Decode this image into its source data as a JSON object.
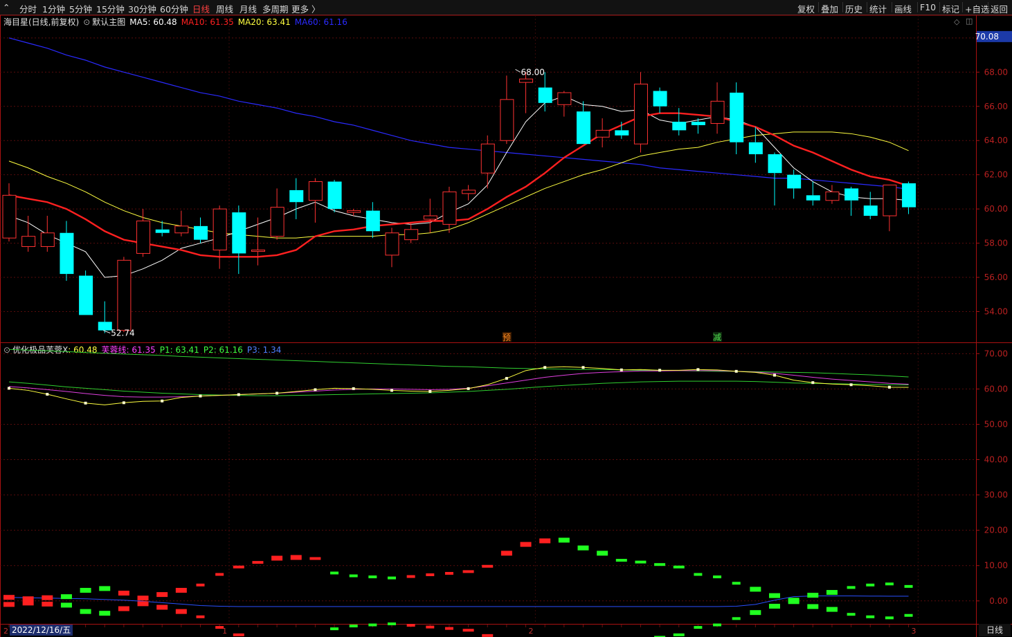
{
  "topbar": {
    "periods": [
      "分时",
      "1分钟",
      "5分钟",
      "15分钟",
      "30分钟",
      "60分钟",
      "日线",
      "周线",
      "月线",
      "多周期",
      "更多 〉"
    ],
    "active_period": "日线",
    "buttons": [
      "复权",
      "叠加",
      "历史",
      "统计",
      "画线",
      "F10",
      "标记",
      "+自选",
      "返回"
    ]
  },
  "main_legend": {
    "stock": "海目星(日线,前复权)",
    "template": "默认主图",
    "items": [
      {
        "label": "MA5: 60.48",
        "color": "#ffffff"
      },
      {
        "label": "MA10: 61.35",
        "color": "#ff2020"
      },
      {
        "label": "MA20: 63.41",
        "color": "#ffff40"
      },
      {
        "label": "MA60: 61.16",
        "color": "#2a2aff"
      }
    ]
  },
  "sub_legend": {
    "name": "优化极品芙蓉X",
    "items": [
      {
        "label": ": 60.48",
        "color": "#ffff40"
      },
      {
        "label": "芙蓉线: 61.35",
        "color": "#ff40ff"
      },
      {
        "label": "P1: 63.41",
        "color": "#40ff40"
      },
      {
        "label": "P2: 61.16",
        "color": "#40ff40"
      },
      {
        "label": "P3: 1.34",
        "color": "#5080ff"
      }
    ]
  },
  "date_label": "2022/12/16/五",
  "period_label": "日线",
  "chart_data": {
    "type": "candlestick",
    "colors": {
      "up": "#ff3232",
      "down": "#00ffff",
      "ma5": "#ffffff",
      "ma10": "#ff2020",
      "ma20": "#ffff40",
      "ma60": "#2a2aff",
      "axis": "#aa1111"
    },
    "main_axis": {
      "ylim": [
        52.2,
        70.6
      ],
      "ticks": [
        "54.00",
        "56.00",
        "58.00",
        "60.00",
        "62.00",
        "64.00",
        "66.00",
        "68.00",
        "70.00"
      ],
      "current_price": "70.08"
    },
    "sub_axis": {
      "ylim": [
        -6.5,
        73
      ],
      "ticks": [
        "0.00",
        "10.00",
        "20.00",
        "30.00",
        "40.00",
        "50.00",
        "60.00",
        "70.00"
      ]
    },
    "annotations": {
      "high": "68.00",
      "low": "52.74",
      "mark_pre": "预",
      "mark_cut": "减"
    },
    "month_labels": [
      "2",
      "1",
      "2",
      "3"
    ],
    "candles": [
      {
        "o": 58.3,
        "h": 61.5,
        "l": 58.1,
        "c": 60.8
      },
      {
        "o": 57.8,
        "h": 59.6,
        "l": 57.5,
        "c": 58.4
      },
      {
        "o": 57.8,
        "h": 59.6,
        "l": 57.5,
        "c": 58.6
      },
      {
        "o": 58.6,
        "h": 59.3,
        "l": 55.8,
        "c": 56.2
      },
      {
        "o": 56.1,
        "h": 56.4,
        "l": 53.8,
        "c": 53.8
      },
      {
        "o": 53.4,
        "h": 54.6,
        "l": 52.74,
        "c": 52.9
      },
      {
        "o": 52.9,
        "h": 57.2,
        "l": 52.8,
        "c": 57.0
      },
      {
        "o": 57.4,
        "h": 60.0,
        "l": 57.2,
        "c": 59.3
      },
      {
        "o": 58.8,
        "h": 59.3,
        "l": 58.4,
        "c": 58.6
      },
      {
        "o": 58.6,
        "h": 59.9,
        "l": 58.4,
        "c": 59.0
      },
      {
        "o": 59.0,
        "h": 59.5,
        "l": 58.0,
        "c": 58.2
      },
      {
        "o": 57.6,
        "h": 60.2,
        "l": 56.5,
        "c": 60.0
      },
      {
        "o": 59.8,
        "h": 60.2,
        "l": 56.2,
        "c": 57.4
      },
      {
        "o": 57.6,
        "h": 59.5,
        "l": 56.7,
        "c": 57.6
      },
      {
        "o": 58.4,
        "h": 61.2,
        "l": 58.2,
        "c": 60.1
      },
      {
        "o": 61.1,
        "h": 61.8,
        "l": 59.4,
        "c": 60.4
      },
      {
        "o": 60.5,
        "h": 61.8,
        "l": 59.2,
        "c": 61.6
      },
      {
        "o": 61.6,
        "h": 61.7,
        "l": 59.8,
        "c": 60.0
      },
      {
        "o": 59.8,
        "h": 60.0,
        "l": 59.6,
        "c": 59.9
      },
      {
        "o": 59.9,
        "h": 60.4,
        "l": 58.3,
        "c": 58.7
      },
      {
        "o": 57.3,
        "h": 58.9,
        "l": 56.6,
        "c": 58.6
      },
      {
        "o": 58.2,
        "h": 59.2,
        "l": 58.0,
        "c": 58.8
      },
      {
        "o": 59.4,
        "h": 60.6,
        "l": 58.6,
        "c": 59.6
      },
      {
        "o": 59.1,
        "h": 61.3,
        "l": 58.6,
        "c": 61.0
      },
      {
        "o": 60.9,
        "h": 61.4,
        "l": 60.5,
        "c": 61.1
      },
      {
        "o": 62.1,
        "h": 64.3,
        "l": 61.2,
        "c": 63.8
      },
      {
        "o": 64.0,
        "h": 67.8,
        "l": 63.8,
        "c": 66.4
      },
      {
        "o": 67.4,
        "h": 68.0,
        "l": 65.6,
        "c": 67.6
      },
      {
        "o": 67.1,
        "h": 68.0,
        "l": 65.7,
        "c": 66.2
      },
      {
        "o": 66.1,
        "h": 66.9,
        "l": 65.4,
        "c": 66.8
      },
      {
        "o": 65.7,
        "h": 66.3,
        "l": 63.8,
        "c": 63.8
      },
      {
        "o": 64.2,
        "h": 65.3,
        "l": 63.6,
        "c": 64.6
      },
      {
        "o": 64.6,
        "h": 65.1,
        "l": 64.1,
        "c": 64.3
      },
      {
        "o": 63.8,
        "h": 68.0,
        "l": 63.3,
        "c": 67.3
      },
      {
        "o": 66.9,
        "h": 67.1,
        "l": 65.6,
        "c": 66.0
      },
      {
        "o": 65.1,
        "h": 65.9,
        "l": 64.3,
        "c": 64.6
      },
      {
        "o": 65.1,
        "h": 65.3,
        "l": 64.4,
        "c": 64.9
      },
      {
        "o": 65.0,
        "h": 67.4,
        "l": 64.4,
        "c": 66.3
      },
      {
        "o": 66.8,
        "h": 67.4,
        "l": 63.2,
        "c": 63.9
      },
      {
        "o": 63.9,
        "h": 64.8,
        "l": 62.7,
        "c": 63.2
      },
      {
        "o": 63.2,
        "h": 63.3,
        "l": 60.2,
        "c": 62.1
      },
      {
        "o": 62.0,
        "h": 62.3,
        "l": 60.6,
        "c": 61.2
      },
      {
        "o": 60.8,
        "h": 61.6,
        "l": 60.2,
        "c": 60.5
      },
      {
        "o": 60.5,
        "h": 61.4,
        "l": 60.3,
        "c": 61.0
      },
      {
        "o": 61.2,
        "h": 61.3,
        "l": 59.6,
        "c": 60.5
      },
      {
        "o": 60.2,
        "h": 61.0,
        "l": 59.4,
        "c": 59.6
      },
      {
        "o": 59.6,
        "h": 61.4,
        "l": 58.7,
        "c": 61.4
      },
      {
        "o": 61.5,
        "h": 61.6,
        "l": 59.7,
        "c": 60.1
      }
    ],
    "ma5": [
      59.6,
      59.2,
      58.5,
      58.0,
      57.5,
      56.0,
      56.1,
      56.5,
      57.0,
      57.7,
      58.0,
      58.3,
      58.7,
      59.1,
      59.5,
      60.0,
      60.4,
      59.9,
      59.6,
      59.4,
      59.2,
      59.1,
      59.2,
      59.8,
      60.3,
      61.4,
      63.3,
      65.1,
      66.2,
      66.6,
      66.1,
      66.0,
      65.7,
      65.8,
      65.2,
      65.0,
      65.2,
      65.4,
      65.2,
      64.8,
      63.6,
      62.4,
      61.6,
      61.0,
      60.7,
      60.6,
      60.6,
      60.5
    ],
    "ma10": [
      60.8,
      60.6,
      60.4,
      60.0,
      59.4,
      58.7,
      58.2,
      58.0,
      57.8,
      57.6,
      57.3,
      57.2,
      57.2,
      57.2,
      57.3,
      57.6,
      58.4,
      58.7,
      58.8,
      59.0,
      59.1,
      59.2,
      59.3,
      59.3,
      59.4,
      60.0,
      60.7,
      61.3,
      62.1,
      63.0,
      63.7,
      64.4,
      64.9,
      65.4,
      65.6,
      65.6,
      65.5,
      65.4,
      65.1,
      64.8,
      64.3,
      63.7,
      63.3,
      62.8,
      62.3,
      61.9,
      61.7,
      61.35
    ],
    "ma20": [
      62.8,
      62.4,
      61.9,
      61.5,
      61.0,
      60.4,
      59.9,
      59.5,
      59.2,
      59.0,
      58.8,
      58.6,
      58.5,
      58.4,
      58.3,
      58.3,
      58.4,
      58.4,
      58.4,
      58.4,
      58.5,
      58.5,
      58.6,
      58.8,
      59.2,
      59.7,
      60.2,
      60.7,
      61.2,
      61.6,
      62.0,
      62.3,
      62.7,
      63.1,
      63.3,
      63.5,
      63.6,
      63.9,
      64.1,
      64.3,
      64.4,
      64.5,
      64.5,
      64.5,
      64.4,
      64.2,
      63.9,
      63.41
    ],
    "ma60": [
      70.0,
      69.7,
      69.4,
      69.0,
      68.7,
      68.3,
      68.0,
      67.7,
      67.4,
      67.1,
      66.8,
      66.6,
      66.3,
      66.1,
      65.9,
      65.6,
      65.4,
      65.1,
      64.9,
      64.6,
      64.3,
      64.0,
      63.8,
      63.6,
      63.5,
      63.4,
      63.3,
      63.2,
      63.1,
      63.0,
      62.9,
      62.8,
      62.7,
      62.6,
      62.4,
      62.3,
      62.2,
      62.1,
      62.0,
      61.9,
      61.8,
      61.8,
      61.7,
      61.6,
      61.5,
      61.4,
      61.3,
      61.16
    ],
    "fr_yellow": [
      60.2,
      59.6,
      58.5,
      57.2,
      56.0,
      55.5,
      56.1,
      56.5,
      56.6,
      57.6,
      58.0,
      58.2,
      58.4,
      58.6,
      58.8,
      59.3,
      59.8,
      60.2,
      60.1,
      59.9,
      59.6,
      59.4,
      59.3,
      59.6,
      60.1,
      61.2,
      63.0,
      65.2,
      66.1,
      66.3,
      66.1,
      65.8,
      65.4,
      65.5,
      65.3,
      65.3,
      65.5,
      65.4,
      65.0,
      64.7,
      63.9,
      62.5,
      61.8,
      61.4,
      61.2,
      60.9,
      60.5,
      60.48
    ],
    "fr_magenta": [
      60.7,
      60.3,
      59.8,
      59.3,
      58.7,
      58.2,
      57.8,
      57.7,
      57.7,
      57.8,
      58.0,
      58.2,
      58.4,
      58.6,
      58.8,
      59.1,
      59.4,
      59.7,
      59.9,
      60.0,
      60.0,
      59.9,
      59.8,
      59.9,
      60.2,
      60.9,
      61.7,
      62.5,
      63.3,
      63.9,
      64.4,
      64.7,
      64.9,
      65.1,
      65.1,
      65.2,
      65.2,
      65.2,
      65.0,
      64.8,
      64.4,
      63.9,
      63.3,
      62.8,
      62.4,
      62.0,
      61.6,
      61.35
    ],
    "fr_green1": [
      71.2,
      71.0,
      70.8,
      70.6,
      70.3,
      70.1,
      69.9,
      69.7,
      69.5,
      69.2,
      69.0,
      68.8,
      68.6,
      68.4,
      68.2,
      68.0,
      67.8,
      67.6,
      67.4,
      67.2,
      67.0,
      66.8,
      66.6,
      66.4,
      66.3,
      66.1,
      65.9,
      65.8,
      65.7,
      65.6,
      65.5,
      65.5,
      65.4,
      65.3,
      65.3,
      65.2,
      65.1,
      65.0,
      65.0,
      64.9,
      64.8,
      64.7,
      64.6,
      64.4,
      64.2,
      64.0,
      63.7,
      63.41
    ],
    "fr_green2": [
      62.0,
      61.6,
      61.1,
      60.6,
      60.2,
      59.8,
      59.4,
      59.1,
      58.8,
      58.6,
      58.4,
      58.3,
      58.2,
      58.1,
      58.1,
      58.2,
      58.3,
      58.4,
      58.5,
      58.6,
      58.7,
      58.8,
      58.9,
      59.1,
      59.3,
      59.6,
      59.9,
      60.3,
      60.7,
      61.0,
      61.3,
      61.6,
      61.8,
      62.0,
      62.1,
      62.2,
      62.2,
      62.2,
      62.2,
      62.1,
      61.9,
      61.7,
      61.6,
      61.5,
      61.4,
      61.3,
      61.2,
      61.16
    ],
    "p3": [
      1.0,
      0.9,
      0.8,
      0.7,
      0.6,
      0.4,
      0.2,
      -0.1,
      -0.5,
      -0.9,
      -1.3,
      -1.5,
      -1.6,
      -1.6,
      -1.6,
      -1.6,
      -1.6,
      -1.6,
      -1.6,
      -1.6,
      -1.6,
      -1.6,
      -1.6,
      -1.6,
      -1.6,
      -1.6,
      -1.6,
      -1.6,
      -1.6,
      -1.6,
      -1.6,
      -1.6,
      -1.6,
      -1.6,
      -1.6,
      -1.6,
      -1.6,
      -1.6,
      -1.5,
      -1.0,
      0.2,
      1.2,
      1.4,
      1.4,
      1.4,
      1.35,
      1.34,
      1.34
    ],
    "osc": [
      1.0,
      0.6,
      0.9,
      1.2,
      3.0,
      3.5,
      2.2,
      -0.8,
      -1.8,
      3.0,
      4.5,
      7.5,
      9.6,
      10.9,
      12.1,
      12.3,
      12.0,
      7.9,
      7.1,
      6.8,
      6.5,
      6.9,
      7.4,
      7.8,
      8.3,
      9.8,
      13.5,
      16.0,
      17.0,
      17.2,
      15.0,
      13.5,
      11.5,
      11.0,
      10.3,
      9.6,
      7.5,
      6.8,
      5.0,
      3.3,
      1.5,
      -0.2,
      1.6,
      2.4,
      3.8,
      4.5,
      4.8,
      4.1
    ],
    "osc_color": [
      "r",
      "r",
      "r",
      "g",
      "g",
      "g",
      "r",
      "r",
      "r",
      "r",
      "r",
      "r",
      "r",
      "r",
      "r",
      "r",
      "r",
      "g",
      "g",
      "g",
      "g",
      "r",
      "r",
      "r",
      "r",
      "r",
      "r",
      "r",
      "r",
      "g",
      "g",
      "g",
      "g",
      "g",
      "g",
      "g",
      "g",
      "g",
      "g",
      "g",
      "g",
      "g",
      "g",
      "g",
      "g",
      "g",
      "g",
      "g"
    ]
  }
}
